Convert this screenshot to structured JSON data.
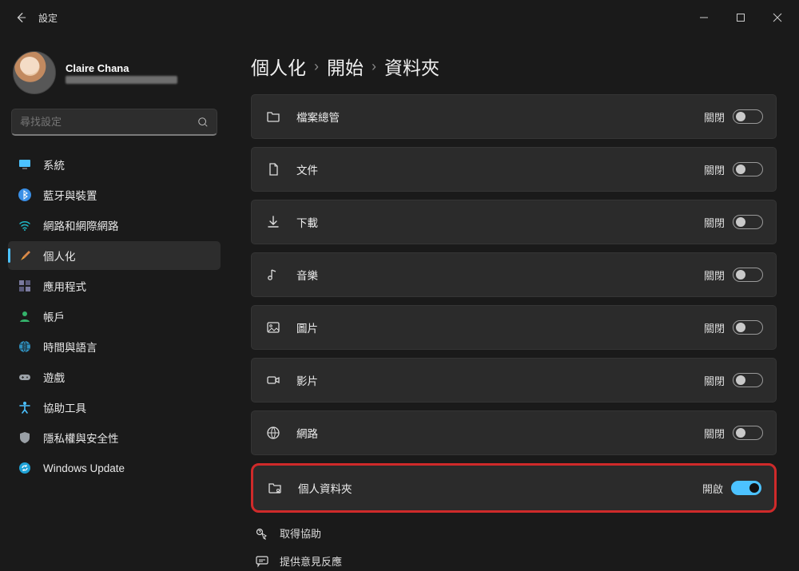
{
  "window": {
    "title": "設定"
  },
  "profile": {
    "name": "Claire Chana"
  },
  "search": {
    "placeholder": "尋找設定"
  },
  "sidebar": {
    "items": [
      {
        "label": "系統",
        "icon": "monitor-icon",
        "color": "#4cc2ff"
      },
      {
        "label": "藍牙與裝置",
        "icon": "bluetooth-icon",
        "color": "#3a8fe6"
      },
      {
        "label": "網路和網際網路",
        "icon": "wifi-icon",
        "color": "#1fb6c4"
      },
      {
        "label": "個人化",
        "icon": "brush-icon",
        "color": "#f2a33c",
        "active": true
      },
      {
        "label": "應用程式",
        "icon": "apps-icon",
        "color": "#7a7a9e"
      },
      {
        "label": "帳戶",
        "icon": "person-icon",
        "color": "#34b36b"
      },
      {
        "label": "時間與語言",
        "icon": "globe-icon",
        "color": "#2f8fbd"
      },
      {
        "label": "遊戲",
        "icon": "gamepad-icon",
        "color": "#9aa0a6"
      },
      {
        "label": "協助工具",
        "icon": "accessibility-icon",
        "color": "#4cc2ff"
      },
      {
        "label": "隱私權與安全性",
        "icon": "shield-icon",
        "color": "#9aa0a6"
      },
      {
        "label": "Windows Update",
        "icon": "update-icon",
        "color": "#1fa2d6"
      }
    ]
  },
  "breadcrumb": [
    "個人化",
    "開始",
    "資料夾"
  ],
  "state_labels": {
    "off": "關閉",
    "on": "開啟"
  },
  "folders": [
    {
      "label": "檔案總管",
      "icon": "explorer-icon",
      "on": false
    },
    {
      "label": "文件",
      "icon": "document-icon",
      "on": false
    },
    {
      "label": "下載",
      "icon": "download-icon",
      "on": false
    },
    {
      "label": "音樂",
      "icon": "music-icon",
      "on": false
    },
    {
      "label": "圖片",
      "icon": "picture-icon",
      "on": false
    },
    {
      "label": "影片",
      "icon": "video-icon",
      "on": false
    },
    {
      "label": "網路",
      "icon": "network-icon",
      "on": false
    },
    {
      "label": "個人資料夾",
      "icon": "personal-folder-icon",
      "on": true,
      "highlight": true
    }
  ],
  "help": [
    {
      "label": "取得協助",
      "icon": "help-icon"
    },
    {
      "label": "提供意見反應",
      "icon": "feedback-icon"
    }
  ]
}
